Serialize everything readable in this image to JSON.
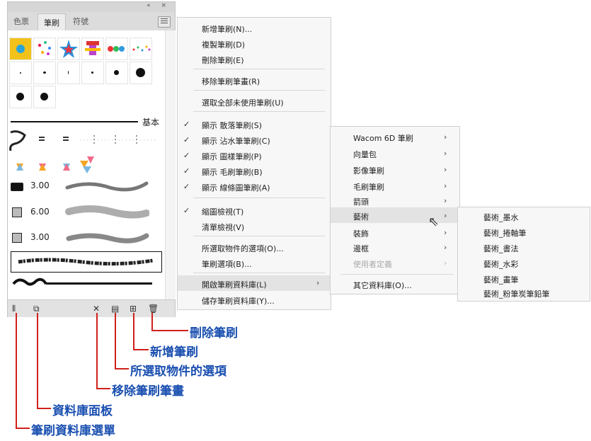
{
  "panel": {
    "controls": "« ×",
    "tabs": [
      "色票",
      "筆刷",
      "符號"
    ],
    "basic_label": "基本",
    "sizes": [
      "3.00",
      "6.00",
      "3.00"
    ]
  },
  "context_menu": {
    "items": [
      {
        "label": "新增筆刷(N)...",
        "checked": false
      },
      {
        "label": "複製筆刷(D)",
        "checked": false
      },
      {
        "label": "刪除筆刷(E)",
        "checked": false
      },
      {
        "label": "移除筆刷筆畫(R)",
        "checked": false
      },
      {
        "label": "選取全部未使用筆刷(U)",
        "checked": false
      },
      {
        "label": "顯示 散落筆刷(S)",
        "checked": true
      },
      {
        "label": "顯示 沾水筆筆刷(C)",
        "checked": true
      },
      {
        "label": "顯示 圖樣筆刷(P)",
        "checked": true
      },
      {
        "label": "顯示 毛刷筆刷(B)",
        "checked": true
      },
      {
        "label": "顯示 線條圖筆刷(A)",
        "checked": true
      },
      {
        "label": "縮圖檢視(T)",
        "checked": true
      },
      {
        "label": "清單檢視(V)",
        "checked": false
      },
      {
        "label": "所選取物件的選項(O)...",
        "checked": false
      },
      {
        "label": "筆刷選項(B)...",
        "checked": false
      },
      {
        "label": "開啟筆刷資料庫(L)",
        "checked": false
      },
      {
        "label": "儲存筆刷資料庫(Y)...",
        "checked": false
      }
    ]
  },
  "submenu_library": {
    "items": [
      "Wacom 6D 筆刷",
      "向量包",
      "影像筆刷",
      "毛刷筆刷",
      "箭頭",
      "藝術",
      "裝飾",
      "邊框",
      "使用者定義"
    ],
    "other": "其它資料庫(O)..."
  },
  "submenu_art": {
    "items": [
      "藝術_墨水",
      "藝術_捲軸筆",
      "藝術_書法",
      "藝術_水彩",
      "藝術_畫筆",
      "藝術_粉筆炭筆鉛筆"
    ]
  },
  "annotations": {
    "delete": "刪除筆刷",
    "new": "新增筆刷",
    "options": "所選取物件的選項",
    "remove": "移除筆刷筆畫",
    "library_panel": "資料庫面板",
    "library_menu": "筆刷資料庫選單"
  },
  "colors": {
    "annotation_text": "#1a4fb0",
    "annotation_line": "#d0211c"
  }
}
